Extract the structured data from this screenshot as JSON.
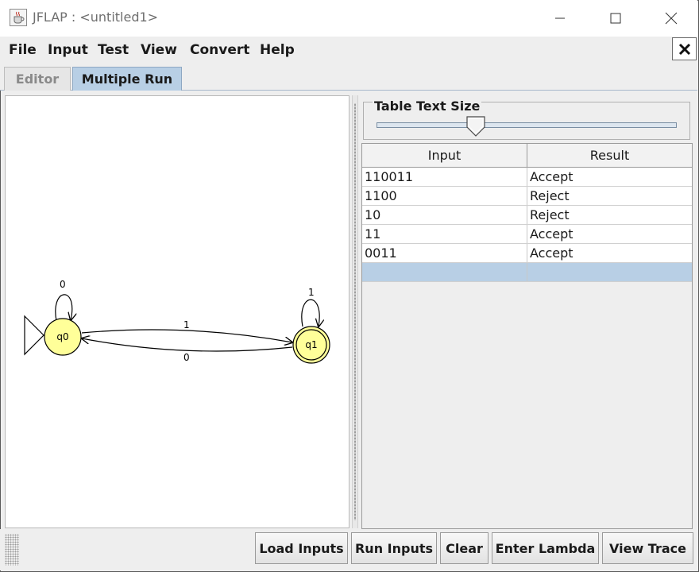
{
  "window": {
    "title": "JFLAP : <untitled1>"
  },
  "menubar": {
    "items": [
      "File",
      "Input",
      "Test",
      "View",
      "Convert",
      "Help"
    ]
  },
  "tabs": [
    {
      "label": "Editor",
      "selected": false
    },
    {
      "label": "Multiple Run",
      "selected": true
    }
  ],
  "automaton": {
    "states": [
      {
        "label": "q0",
        "initial": true,
        "final": false
      },
      {
        "label": "q1",
        "initial": false,
        "final": true
      }
    ],
    "transitions": [
      {
        "from": "q0",
        "to": "q0",
        "label": "0"
      },
      {
        "from": "q0",
        "to": "q1",
        "label": "1"
      },
      {
        "from": "q1",
        "to": "q0",
        "label": "0"
      },
      {
        "from": "q1",
        "to": "q1",
        "label": "1"
      }
    ]
  },
  "slider": {
    "title": "Table Text Size",
    "level": 0.33
  },
  "table": {
    "headers": [
      "Input",
      "Result"
    ],
    "rows": [
      {
        "input": "110011",
        "result": "Accept"
      },
      {
        "input": "1100",
        "result": "Reject"
      },
      {
        "input": "10",
        "result": "Reject"
      },
      {
        "input": "11",
        "result": "Accept"
      },
      {
        "input": "0011",
        "result": "Accept"
      },
      {
        "input": "",
        "result": ""
      }
    ]
  },
  "buttons": {
    "load": "Load Inputs",
    "run": "Run Inputs",
    "clear": "Clear",
    "lambda": "Enter Lambda",
    "trace": "View Trace"
  },
  "colors": {
    "state_fill": "#ffff99",
    "tab_selected": "#b8cfe5",
    "row_selected": "#b8cfe5"
  }
}
